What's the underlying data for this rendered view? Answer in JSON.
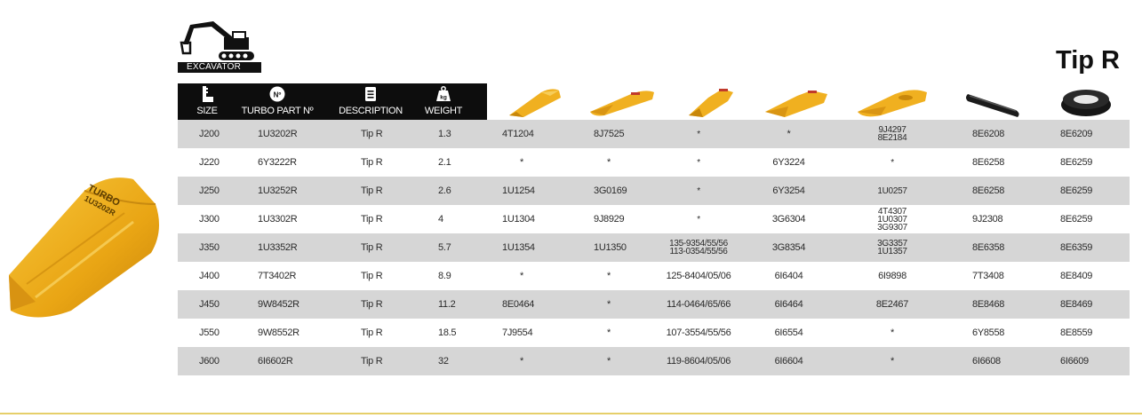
{
  "badge": {
    "label": "EXCAVATOR",
    "icon": "excavator-icon"
  },
  "title": "Tip R",
  "header": {
    "size": "SIZE",
    "part": "TURBO PART Nº",
    "description": "DESCRIPTION",
    "weight": "WEIGHT",
    "size_icon": "ruler-icon",
    "part_icon": "number-icon",
    "desc_icon": "document-icon",
    "weight_icon": "weight-kg-icon",
    "weight_icon_text": "kg",
    "part_icon_text": "Nº"
  },
  "product_images": [
    "tooth-icon-1",
    "tooth-icon-2",
    "tooth-icon-3",
    "tooth-icon-4",
    "tooth-icon-5",
    "pin-icon",
    "retainer-icon"
  ],
  "product_photo": {
    "brand": "TURBO",
    "code": "1U3202R"
  },
  "rows": [
    {
      "size": "J200",
      "part": "1U3202R",
      "desc": "Tip R",
      "weight": "1.3",
      "c1": "4T1204",
      "c2": "8J7525",
      "c3": [
        "*"
      ],
      "c4": "*",
      "c5": [
        "9J4297",
        "8E2184"
      ],
      "c6": "8E6208",
      "c7": "8E6209"
    },
    {
      "size": "J220",
      "part": "6Y3222R",
      "desc": "Tip R",
      "weight": "2.1",
      "c1": "*",
      "c2": "*",
      "c3": [
        "*"
      ],
      "c4": "6Y3224",
      "c5": [
        "*"
      ],
      "c6": "8E6258",
      "c7": "8E6259"
    },
    {
      "size": "J250",
      "part": "1U3252R",
      "desc": "Tip R",
      "weight": "2.6",
      "c1": "1U1254",
      "c2": "3G0169",
      "c3": [
        "*"
      ],
      "c4": "6Y3254",
      "c5": [
        "1U0257"
      ],
      "c6": "8E6258",
      "c7": "8E6259"
    },
    {
      "size": "J300",
      "part": "1U3302R",
      "desc": "Tip R",
      "weight": "4",
      "c1": "1U1304",
      "c2": "9J8929",
      "c3": [
        "*"
      ],
      "c4": "3G6304",
      "c5": [
        "4T4307",
        "1U0307",
        "3G9307"
      ],
      "c6": "9J2308",
      "c7": "8E6259"
    },
    {
      "size": "J350",
      "part": "1U3352R",
      "desc": "Tip R",
      "weight": "5.7",
      "c1": "1U1354",
      "c2": "1U1350",
      "c3": [
        "135-9354/55/56",
        "113-0354/55/56"
      ],
      "c4": "3G8354",
      "c5": [
        "3G3357",
        "1U1357"
      ],
      "c6": "8E6358",
      "c7": "8E6359"
    },
    {
      "size": "J400",
      "part": "7T3402R",
      "desc": "Tip R",
      "weight": "8.9",
      "c1": "*",
      "c2": "*",
      "c3": [
        "125-8404/05/06"
      ],
      "c4": "6I6404",
      "c5": [
        "6I9898"
      ],
      "c6": "7T3408",
      "c7": "8E8409"
    },
    {
      "size": "J450",
      "part": "9W8452R",
      "desc": "Tip R",
      "weight": "11.2",
      "c1": "8E0464",
      "c2": "*",
      "c3": [
        "114-0464/65/66"
      ],
      "c4": "6I6464",
      "c5": [
        "8E2467"
      ],
      "c6": "8E8468",
      "c7": "8E8469"
    },
    {
      "size": "J550",
      "part": "9W8552R",
      "desc": "Tip R",
      "weight": "18.5",
      "c1": "7J9554",
      "c2": "*",
      "c3": [
        "107-3554/55/56"
      ],
      "c4": "6I6554",
      "c5": [
        "*"
      ],
      "c6": "6Y8558",
      "c7": "8E8559"
    },
    {
      "size": "J600",
      "part": "6I6602R",
      "desc": "Tip R",
      "weight": "32",
      "c1": "*",
      "c2": "*",
      "c3": [
        "119-8604/05/06"
      ],
      "c4": "6I6604",
      "c5": [
        "*"
      ],
      "c6": "6I6608",
      "c7": "6I6609"
    }
  ],
  "colors": {
    "header_bg": "#0d0d0d",
    "row_alt": "#d6d6d6",
    "tooth": "#f0b020",
    "accent_rule": "#e6cf6a"
  }
}
